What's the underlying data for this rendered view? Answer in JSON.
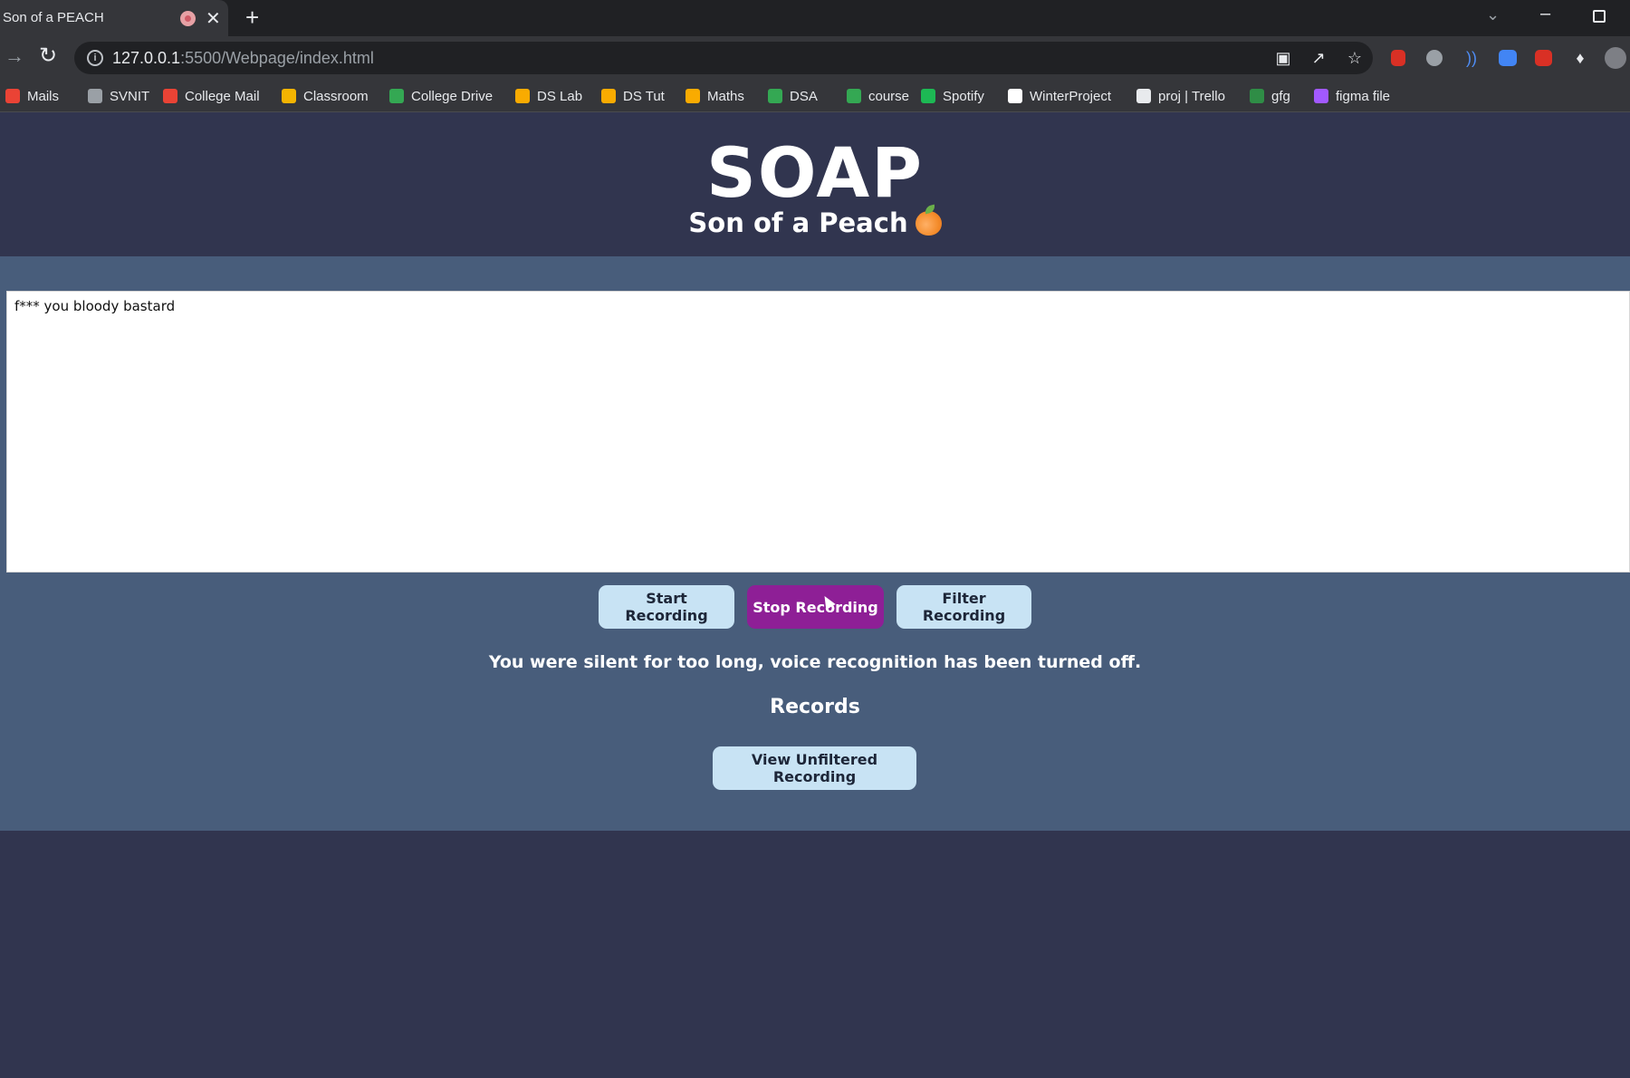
{
  "browser": {
    "tab_title": "Son of a PEACH",
    "close_glyph": "✕",
    "new_tab_glyph": "+",
    "url_host": "127.0.0.1",
    "url_path": ":5500/Webpage/index.html",
    "bookmarks": [
      {
        "label": "Mails",
        "icon": "gmail-icon",
        "color": "#ea4335"
      },
      {
        "label": "SVNIT",
        "icon": "location-icon",
        "color": "#9aa0a6"
      },
      {
        "label": "College Mail",
        "icon": "gmail-icon",
        "color": "#ea4335"
      },
      {
        "label": "Classroom",
        "icon": "classroom-icon",
        "color": "#f4b400"
      },
      {
        "label": "College Drive",
        "icon": "drive-icon",
        "color": "#34a853"
      },
      {
        "label": "DS Lab",
        "icon": "colab-icon",
        "color": "#f9ab00"
      },
      {
        "label": "DS Tut",
        "icon": "colab-icon",
        "color": "#f9ab00"
      },
      {
        "label": "Maths",
        "icon": "colab-icon",
        "color": "#f9ab00"
      },
      {
        "label": "DSA",
        "icon": "sheet-4-icon",
        "color": "#34a853"
      },
      {
        "label": "course",
        "icon": "drive-icon",
        "color": "#34a853"
      },
      {
        "label": "Spotify",
        "icon": "spotify-icon",
        "color": "#1db954"
      },
      {
        "label": "WinterProject",
        "icon": "github-icon",
        "color": "#ffffff"
      },
      {
        "label": "proj | Trello",
        "icon": "trello-icon",
        "color": "#e8eaed"
      },
      {
        "label": "gfg",
        "icon": "gfg-icon",
        "color": "#2f8d46"
      },
      {
        "label": "figma file",
        "icon": "figma-icon",
        "color": "#a259ff"
      }
    ]
  },
  "app": {
    "logo": "SOAP",
    "tagline": "Son of a Peach",
    "transcript": "f*** you bloody bastard",
    "buttons": {
      "start": "Start Recording",
      "stop": "Stop Recording",
      "filter": "Filter Recording",
      "view_unfiltered": "View Unfiltered Recording"
    },
    "status_message": "You were silent for too long, voice recognition has been turned off.",
    "records_heading": "Records"
  },
  "colors": {
    "page_bg": "#31354f",
    "band_bg": "#485d7b",
    "button_light": "#c8e3f4",
    "button_active": "#8e1f96"
  }
}
